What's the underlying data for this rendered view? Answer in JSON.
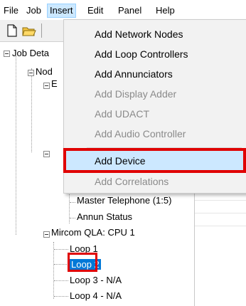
{
  "menubar": {
    "file": "File",
    "job": "Job",
    "insert": "Insert",
    "edit": "Edit",
    "panel": "Panel",
    "help": "Help"
  },
  "insert_menu": {
    "items": [
      {
        "label": "Add Network Nodes",
        "enabled": true
      },
      {
        "label": "Add Loop Controllers",
        "enabled": true
      },
      {
        "label": "Add Annunciators",
        "enabled": true
      },
      {
        "label": "Add Display Adder",
        "enabled": false
      },
      {
        "label": "Add UDACT",
        "enabled": false
      },
      {
        "label": "Add Audio Controller",
        "enabled": false
      },
      {
        "label": "Add Device",
        "enabled": true,
        "highlighted": true
      },
      {
        "label": "Add Correlations",
        "enabled": false
      }
    ]
  },
  "tree": {
    "job_details": "Job Deta",
    "nodes": "Nod",
    "node_child_prefix": "E",
    "master_telephone": "Master Telephone (1:5)",
    "annun_status": "Annun Status",
    "cpu": "Mircom QLA: CPU 1",
    "loops": [
      "Loop 1",
      "Loop 2",
      "Loop 3 - N/A",
      "Loop 4 - N/A"
    ],
    "selected_loop": "Loop 2"
  },
  "colors": {
    "highlight_border": "#e00000",
    "selection_bg": "#0078d7",
    "menu_hover": "#cce8ff"
  }
}
